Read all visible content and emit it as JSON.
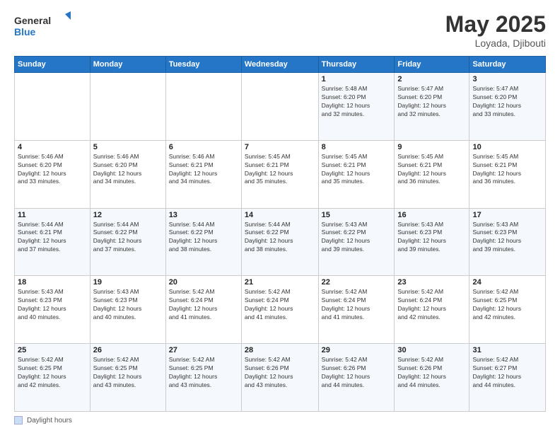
{
  "header": {
    "logo_line1": "General",
    "logo_line2": "Blue",
    "title": "May 2025",
    "location": "Loyada, Djibouti"
  },
  "footer": {
    "box_label": "Daylight hours"
  },
  "days_of_week": [
    "Sunday",
    "Monday",
    "Tuesday",
    "Wednesday",
    "Thursday",
    "Friday",
    "Saturday"
  ],
  "weeks": [
    [
      {
        "day": "",
        "info": ""
      },
      {
        "day": "",
        "info": ""
      },
      {
        "day": "",
        "info": ""
      },
      {
        "day": "",
        "info": ""
      },
      {
        "day": "1",
        "info": "Sunrise: 5:48 AM\nSunset: 6:20 PM\nDaylight: 12 hours\nand 32 minutes."
      },
      {
        "day": "2",
        "info": "Sunrise: 5:47 AM\nSunset: 6:20 PM\nDaylight: 12 hours\nand 32 minutes."
      },
      {
        "day": "3",
        "info": "Sunrise: 5:47 AM\nSunset: 6:20 PM\nDaylight: 12 hours\nand 33 minutes."
      }
    ],
    [
      {
        "day": "4",
        "info": "Sunrise: 5:46 AM\nSunset: 6:20 PM\nDaylight: 12 hours\nand 33 minutes."
      },
      {
        "day": "5",
        "info": "Sunrise: 5:46 AM\nSunset: 6:20 PM\nDaylight: 12 hours\nand 34 minutes."
      },
      {
        "day": "6",
        "info": "Sunrise: 5:46 AM\nSunset: 6:21 PM\nDaylight: 12 hours\nand 34 minutes."
      },
      {
        "day": "7",
        "info": "Sunrise: 5:45 AM\nSunset: 6:21 PM\nDaylight: 12 hours\nand 35 minutes."
      },
      {
        "day": "8",
        "info": "Sunrise: 5:45 AM\nSunset: 6:21 PM\nDaylight: 12 hours\nand 35 minutes."
      },
      {
        "day": "9",
        "info": "Sunrise: 5:45 AM\nSunset: 6:21 PM\nDaylight: 12 hours\nand 36 minutes."
      },
      {
        "day": "10",
        "info": "Sunrise: 5:45 AM\nSunset: 6:21 PM\nDaylight: 12 hours\nand 36 minutes."
      }
    ],
    [
      {
        "day": "11",
        "info": "Sunrise: 5:44 AM\nSunset: 6:21 PM\nDaylight: 12 hours\nand 37 minutes."
      },
      {
        "day": "12",
        "info": "Sunrise: 5:44 AM\nSunset: 6:22 PM\nDaylight: 12 hours\nand 37 minutes."
      },
      {
        "day": "13",
        "info": "Sunrise: 5:44 AM\nSunset: 6:22 PM\nDaylight: 12 hours\nand 38 minutes."
      },
      {
        "day": "14",
        "info": "Sunrise: 5:44 AM\nSunset: 6:22 PM\nDaylight: 12 hours\nand 38 minutes."
      },
      {
        "day": "15",
        "info": "Sunrise: 5:43 AM\nSunset: 6:22 PM\nDaylight: 12 hours\nand 39 minutes."
      },
      {
        "day": "16",
        "info": "Sunrise: 5:43 AM\nSunset: 6:23 PM\nDaylight: 12 hours\nand 39 minutes."
      },
      {
        "day": "17",
        "info": "Sunrise: 5:43 AM\nSunset: 6:23 PM\nDaylight: 12 hours\nand 39 minutes."
      }
    ],
    [
      {
        "day": "18",
        "info": "Sunrise: 5:43 AM\nSunset: 6:23 PM\nDaylight: 12 hours\nand 40 minutes."
      },
      {
        "day": "19",
        "info": "Sunrise: 5:43 AM\nSunset: 6:23 PM\nDaylight: 12 hours\nand 40 minutes."
      },
      {
        "day": "20",
        "info": "Sunrise: 5:42 AM\nSunset: 6:24 PM\nDaylight: 12 hours\nand 41 minutes."
      },
      {
        "day": "21",
        "info": "Sunrise: 5:42 AM\nSunset: 6:24 PM\nDaylight: 12 hours\nand 41 minutes."
      },
      {
        "day": "22",
        "info": "Sunrise: 5:42 AM\nSunset: 6:24 PM\nDaylight: 12 hours\nand 41 minutes."
      },
      {
        "day": "23",
        "info": "Sunrise: 5:42 AM\nSunset: 6:24 PM\nDaylight: 12 hours\nand 42 minutes."
      },
      {
        "day": "24",
        "info": "Sunrise: 5:42 AM\nSunset: 6:25 PM\nDaylight: 12 hours\nand 42 minutes."
      }
    ],
    [
      {
        "day": "25",
        "info": "Sunrise: 5:42 AM\nSunset: 6:25 PM\nDaylight: 12 hours\nand 42 minutes."
      },
      {
        "day": "26",
        "info": "Sunrise: 5:42 AM\nSunset: 6:25 PM\nDaylight: 12 hours\nand 43 minutes."
      },
      {
        "day": "27",
        "info": "Sunrise: 5:42 AM\nSunset: 6:25 PM\nDaylight: 12 hours\nand 43 minutes."
      },
      {
        "day": "28",
        "info": "Sunrise: 5:42 AM\nSunset: 6:26 PM\nDaylight: 12 hours\nand 43 minutes."
      },
      {
        "day": "29",
        "info": "Sunrise: 5:42 AM\nSunset: 6:26 PM\nDaylight: 12 hours\nand 44 minutes."
      },
      {
        "day": "30",
        "info": "Sunrise: 5:42 AM\nSunset: 6:26 PM\nDaylight: 12 hours\nand 44 minutes."
      },
      {
        "day": "31",
        "info": "Sunrise: 5:42 AM\nSunset: 6:27 PM\nDaylight: 12 hours\nand 44 minutes."
      }
    ]
  ]
}
